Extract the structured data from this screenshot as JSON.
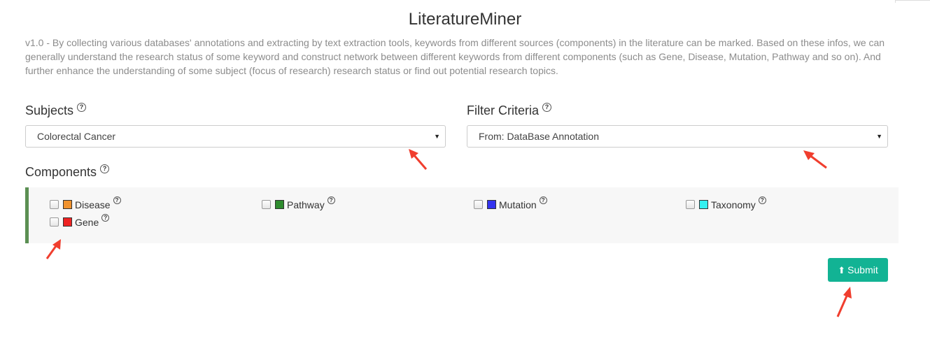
{
  "header": {
    "title": "LiteratureMiner",
    "description": "v1.0 - By collecting various databases' annotations and extracting by text extraction tools, keywords from different sources (components) in the literature can be marked. Based on these infos, we can generally understand the research status of some keyword and construct network between different keywords from different components (such as Gene, Disease, Mutation, Pathway and so on). And further enhance the understanding of some subject (focus of research) research status or find out potential research topics."
  },
  "subjects": {
    "label": "Subjects",
    "selected": "Colorectal Cancer"
  },
  "filter": {
    "label": "Filter Criteria",
    "selected": "From: DataBase Annotation"
  },
  "components": {
    "label": "Components",
    "items": [
      {
        "label": "Disease",
        "color": "#f0922e",
        "checked": false
      },
      {
        "label": "Pathway",
        "color": "#2e8b2e",
        "checked": false
      },
      {
        "label": "Mutation",
        "color": "#3333ee",
        "checked": false
      },
      {
        "label": "Taxonomy",
        "color": "#33f0f0",
        "checked": false
      },
      {
        "label": "Gene",
        "color": "#ee2222",
        "checked": false
      }
    ]
  },
  "submit": {
    "label": "Submit",
    "icon": "arrow-up-icon"
  },
  "colors": {
    "accent": "#12b394",
    "panel_border": "#5b8f53",
    "annotation_arrow": "#f03e2e"
  }
}
